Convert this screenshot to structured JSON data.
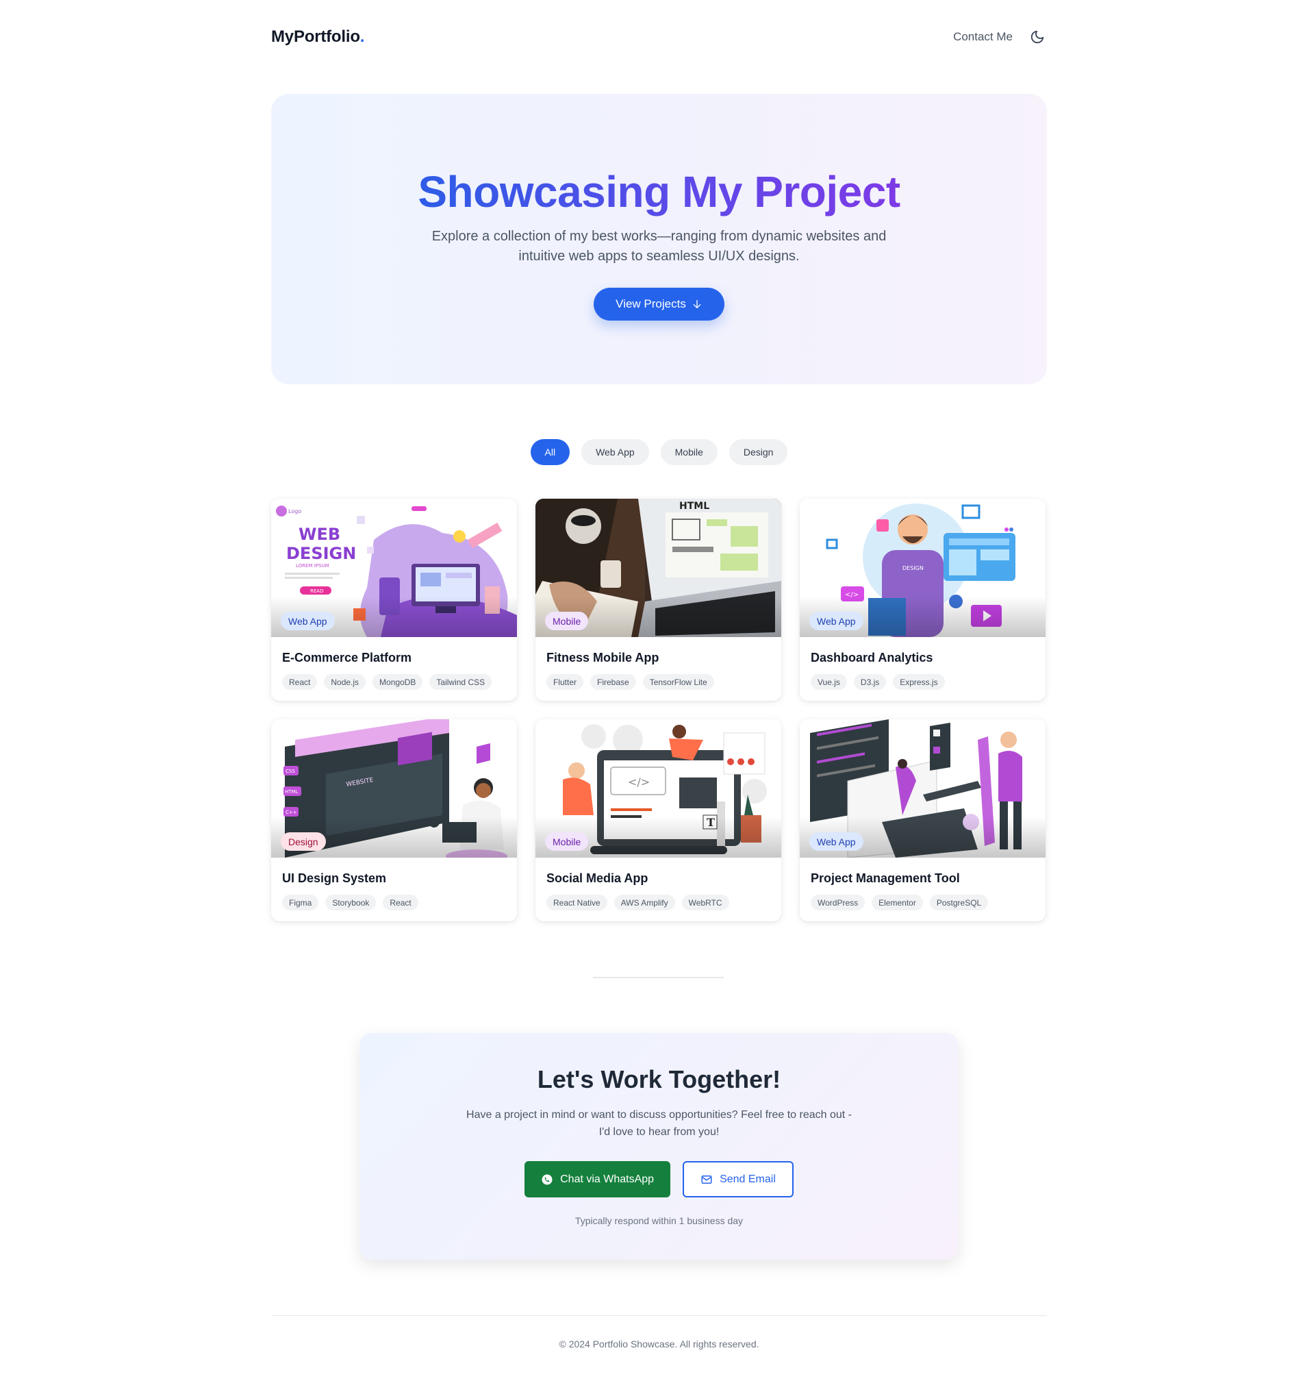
{
  "header": {
    "logo_text": "MyPortfolio",
    "logo_dot": ".",
    "contact_label": "Contact Me",
    "theme_icon": "moon-icon"
  },
  "hero": {
    "title": "Showcasing My Project",
    "subtitle": "Explore a collection of my best works—ranging from dynamic websites and intuitive web apps to seamless UI/UX designs.",
    "button_label": "View Projects",
    "button_icon": "arrow-down-icon"
  },
  "filters": [
    {
      "label": "All",
      "active": true
    },
    {
      "label": "Web App",
      "active": false
    },
    {
      "label": "Mobile",
      "active": false
    },
    {
      "label": "Design",
      "active": false
    }
  ],
  "projects": [
    {
      "category": "Web App",
      "title": "E-Commerce Platform",
      "tags": [
        "React",
        "Node.js",
        "MongoDB",
        "Tailwind CSS"
      ],
      "image": "web-design-illustration"
    },
    {
      "category": "Mobile",
      "title": "Fitness Mobile App",
      "tags": [
        "Flutter",
        "Firebase",
        "TensorFlow Lite"
      ],
      "image": "laptop-wireframe-photo"
    },
    {
      "category": "Web App",
      "title": "Dashboard Analytics",
      "tags": [
        "Vue.js",
        "D3.js",
        "Express.js"
      ],
      "image": "designer-illustration"
    },
    {
      "category": "Design",
      "title": "UI Design System",
      "tags": [
        "Figma",
        "Storybook",
        "React"
      ],
      "image": "website-builder-illustration"
    },
    {
      "category": "Mobile",
      "title": "Social Media App",
      "tags": [
        "React Native",
        "AWS Amplify",
        "WebRTC"
      ],
      "image": "developers-illustration"
    },
    {
      "category": "Web App",
      "title": "Project Management Tool",
      "tags": [
        "WordPress",
        "Elementor",
        "PostgreSQL"
      ],
      "image": "graphic-design-illustration"
    }
  ],
  "cta": {
    "title": "Let's Work Together!",
    "subtitle": "Have a project in mind or want to discuss opportunities? Feel free to reach out - I'd love to hear from you!",
    "whatsapp_label": "Chat via WhatsApp",
    "email_label": "Send Email",
    "note": "Typically respond within 1 business day"
  },
  "footer": {
    "text": "© 2024 Portfolio Showcase. All rights reserved."
  },
  "colors": {
    "accent": "#2563eb",
    "whatsapp": "#15803d",
    "title_gradient_start": "#2d5ce6",
    "title_gradient_end": "#7e3ae6"
  },
  "thumbnail_art": {
    "card1_headline": "WEB",
    "card1_headline2": "DESIGN",
    "card1_small": "LOREM IPSUM",
    "card1_btn": "READ",
    "card1_logo": "Logo",
    "card2_paper": "HTML",
    "card3_shirt": "DESIGN",
    "card4_labels": [
      "CSS",
      "HTML",
      "C++"
    ],
    "card4_site": "WEBSITE",
    "card5_code": "</>",
    "card5_letter": "T"
  }
}
